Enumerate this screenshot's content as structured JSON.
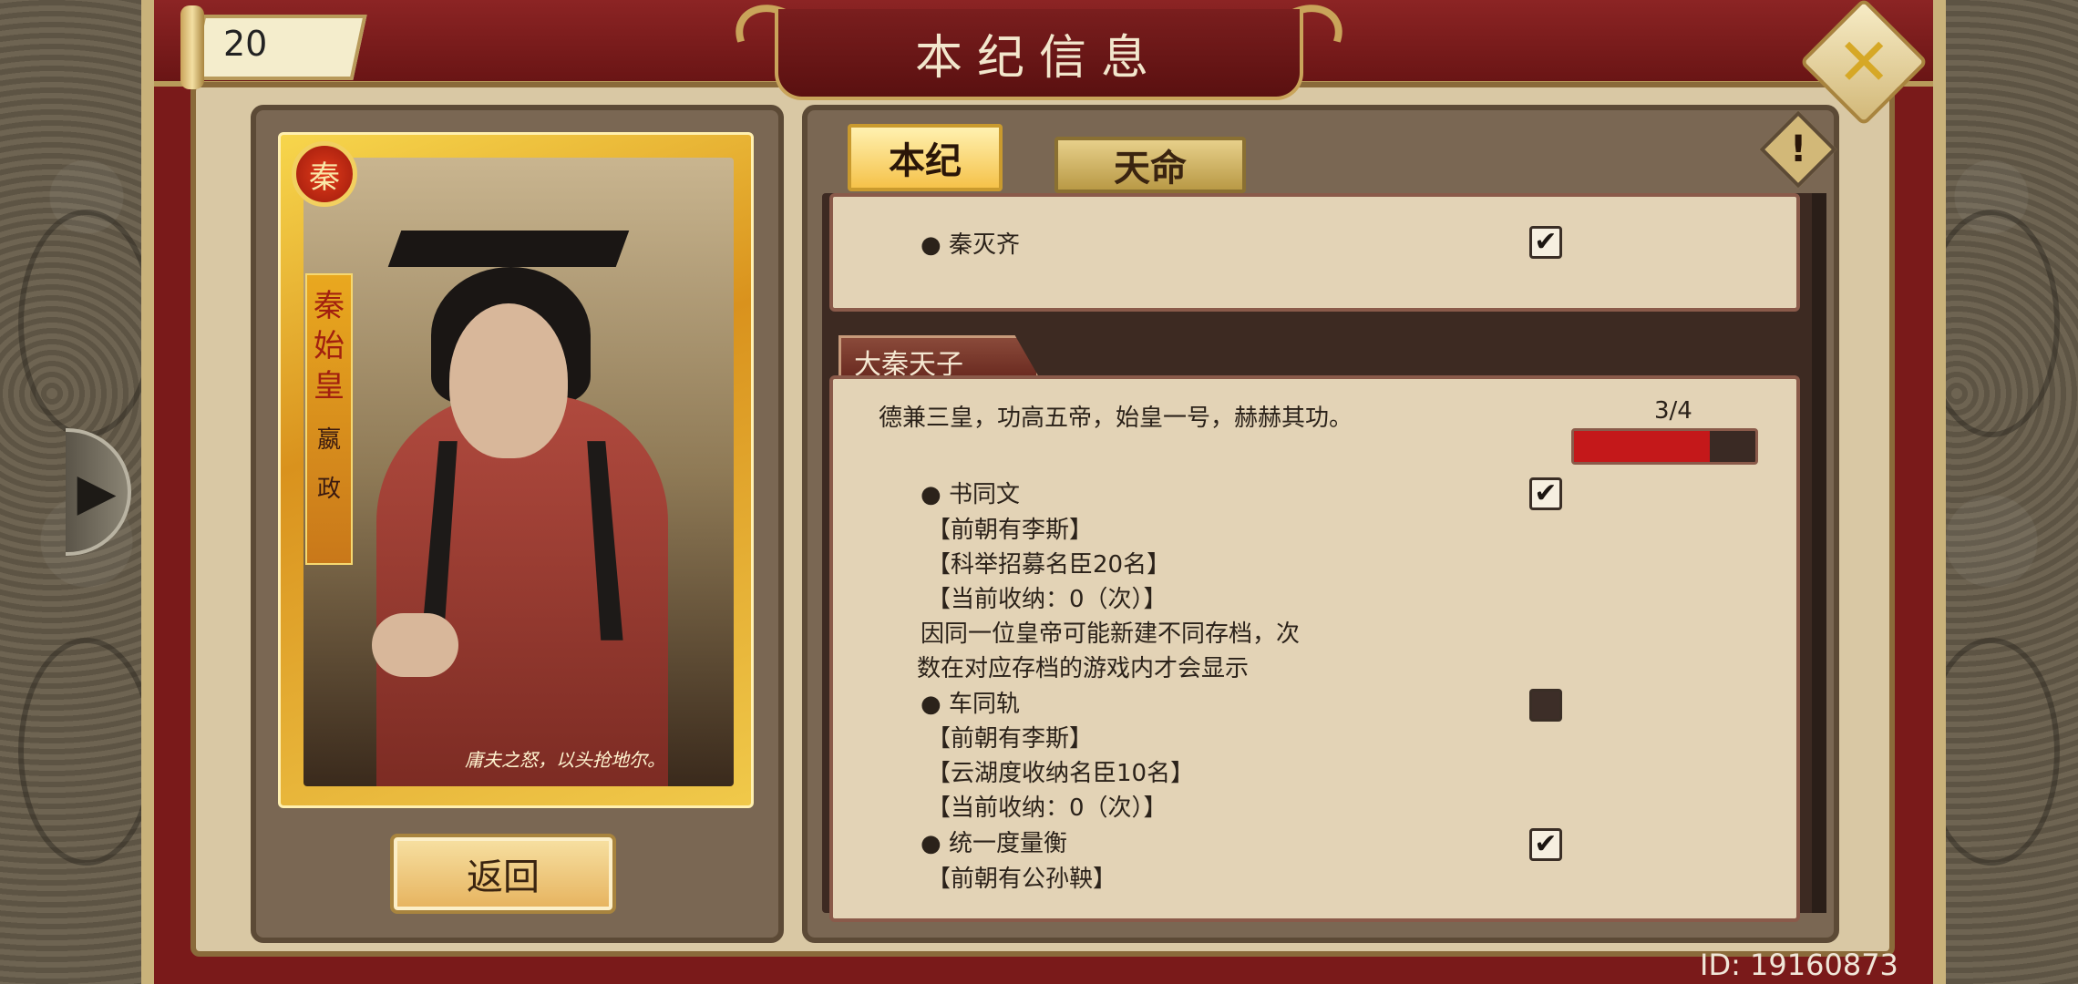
{
  "header": {
    "title": "本纪信息",
    "level": "20"
  },
  "portrait": {
    "seal": "秦",
    "name_chars": [
      "秦",
      "始",
      "皇"
    ],
    "given_name_chars": [
      "嬴",
      "政"
    ],
    "quote": "庸夫之怒，以头抢地尔。"
  },
  "tabs": [
    {
      "label": "本纪",
      "active": true
    },
    {
      "label": "天命",
      "active": false
    }
  ],
  "back_button_label": "返回",
  "prev_section": {
    "item": "● 秦灭齐",
    "checked": true
  },
  "section": {
    "title": "大秦天子",
    "description": "德兼三皇，功高五帝，始皇一号，赫赫其功。",
    "progress_text": "3/4",
    "progress_fraction": 0.75,
    "tasks": [
      {
        "name": "● 书同文",
        "checked": true,
        "details": [
          "【前朝有李斯】",
          "【科举招募名臣20名】",
          "【当前收纳：0（次）】",
          " 因同一位皇帝可能新建不同存档，次",
          "数在对应存档的游戏内才会显示"
        ]
      },
      {
        "name": "● 车同轨",
        "checked": false,
        "details": [
          "【前朝有李斯】",
          "【云湖度收纳名臣10名】",
          "【当前收纳：0（次）】"
        ]
      },
      {
        "name": "● 统一度量衡",
        "checked": true,
        "details": [
          "【前朝有公孙鞅】"
        ]
      }
    ]
  },
  "footer": {
    "id_text": "ID: 19160873"
  },
  "icons": {
    "close": "close-icon",
    "warning": "warning-icon",
    "arrow": "play-arrow-icon",
    "check": "✔"
  },
  "colors": {
    "frame_red": "#7a1a1a",
    "parchment": "#e3d3b6",
    "gold": "#f5c24a",
    "progress": "#c4181a"
  }
}
